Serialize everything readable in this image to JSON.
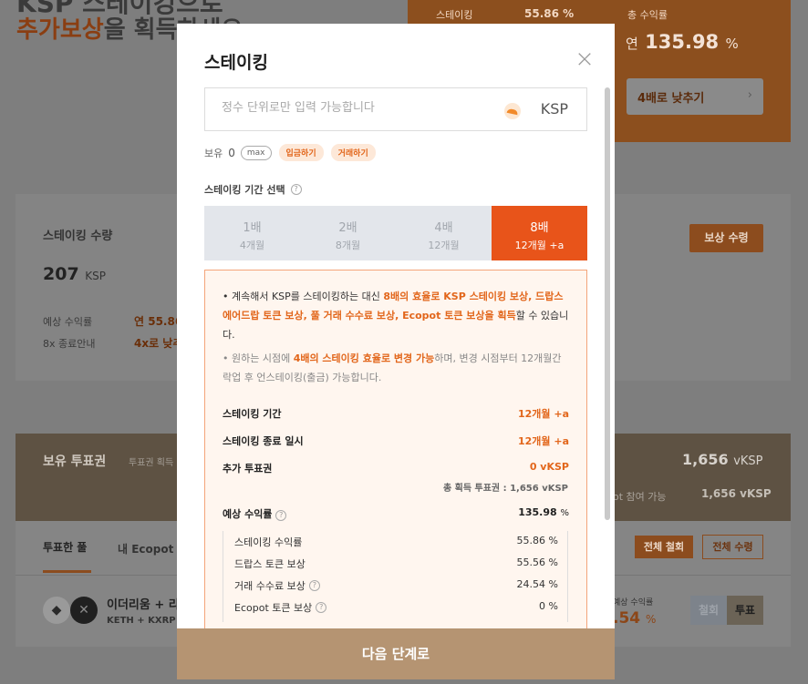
{
  "background": {
    "hero_line1": "KSP 스테이킹으로",
    "hero_line2_accent": "추가보상",
    "hero_line2_rest": "을 획득하세요",
    "orange_card": {
      "staking_label": "스테이킹",
      "staking_value": "55.86 %",
      "total_yield_label": "총 수익률",
      "total_yield_prefix": "연",
      "total_yield_value": "135.98",
      "total_yield_unit": "%",
      "lower_button": "4배로 낮추기",
      "lower_chevron": "›"
    },
    "staking_card": {
      "title": "스테이킹 수량",
      "amount": "207",
      "amount_unit": "KSP",
      "expected_label": "예상 수익률",
      "expected_value": "연 55.86",
      "end_label": "8x 종료안내",
      "end_value": "4x로 낮추",
      "reward_button": "보상 수령"
    },
    "vote_band": {
      "title": "보유 투표권",
      "subtitle": "투표권 획득",
      "value": "1,656",
      "value_unit": "vKSP",
      "sub_label": "ot 참여 가능",
      "sub_value": "1,656 vKSP"
    },
    "list": {
      "tab_voted": "투표한 풀",
      "tab_ecopot": "내 Ecopot",
      "withdraw_all": "전체 철회",
      "claim_all": "전체 수령",
      "pair_name": "이더리움 + 리",
      "pair_tokens": "KETH + KXRP",
      "yield_label": "예상 수익률",
      "yield_value": ".54",
      "yield_unit": "%",
      "toggle_withdraw": "철회",
      "toggle_vote": "투표"
    }
  },
  "modal": {
    "title": "스테이킹",
    "close": "×",
    "input": {
      "placeholder": "정수 단위로만 입력 가능합니다",
      "value": "",
      "unit": "KSP"
    },
    "balance": {
      "label": "보유",
      "value": "0",
      "max": "max",
      "deposit": "입금하기",
      "trade": "거래하기"
    },
    "period_title": "스테이킹 기간 선택",
    "periods": [
      {
        "mult": "1배",
        "months": "4개월",
        "active": false
      },
      {
        "mult": "2배",
        "months": "8개월",
        "active": false
      },
      {
        "mult": "4배",
        "months": "12개월",
        "active": false
      },
      {
        "mult": "8배",
        "months": "12개월 +a",
        "active": true
      }
    ],
    "info": {
      "p1_a": "• 계속해서 KSP를 스테이킹하는 대신 ",
      "p1_hl": "8배의 효율로 KSP 스테이킹 보상, 드랍스에어드랍 토큰 보상, 풀 거래 수수료 보상, Ecopot 토큰 보상을 획득",
      "p1_b": "할 수 있습니다.",
      "p2_a": "• 원하는 시점에 ",
      "p2_hl": "4배의 스테이킹 효율로 변경 가능",
      "p2_b": "하며, 변경 시점부터 12개월간 락업 후 언스테이킹(출금) 가능합니다.",
      "period_label": "스테이킹 기간",
      "period_value": "12개월 +a",
      "end_label": "스테이킹 종료 일시",
      "end_value": "12개월 +a",
      "votes_label": "추가 투표권",
      "votes_value": "0 vKSP",
      "total_votes": "총 획득 투표권 : 1,656 vKSP",
      "yield_label": "예상 수익률",
      "yield_value": "135.98",
      "yield_unit": "%",
      "breakdown": [
        {
          "label": "스테이킹 수익률",
          "value": "55.86",
          "unit": "%",
          "help": false
        },
        {
          "label": "드랍스 토큰 보상",
          "value": "55.56",
          "unit": "%",
          "help": false
        },
        {
          "label": "거래 수수료 보상",
          "value": "24.54",
          "unit": "%",
          "help": true
        },
        {
          "label": "Ecopot 토큰 보상",
          "value": "0",
          "unit": "%",
          "help": true
        }
      ]
    },
    "cta": "다음 단계로"
  },
  "colors": {
    "accent": "#e8541a",
    "cta": "#b59472",
    "info_border": "#f4a57a",
    "info_bg": "#fff6ef"
  }
}
